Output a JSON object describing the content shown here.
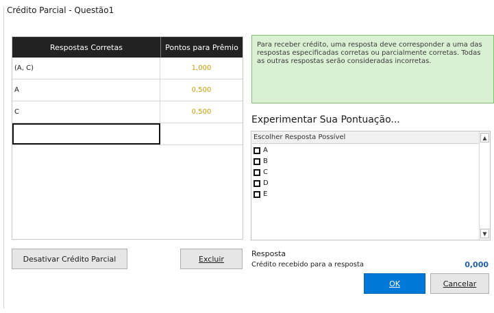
{
  "window": {
    "title": "Crédito Parcial - Questão1"
  },
  "answers_table": {
    "headers": [
      "Respostas Corretas",
      "Pontos para Prêmio"
    ],
    "rows": [
      {
        "answer": "(A, C)",
        "points": "1,000"
      },
      {
        "answer": "A",
        "points": "0,500"
      },
      {
        "answer": "C",
        "points": "0,500"
      },
      {
        "answer": "",
        "points": ""
      }
    ]
  },
  "buttons": {
    "disable_partial_credit": "Desativar Crédito Parcial",
    "delete": "Excluir",
    "ok": "OK",
    "cancel": "Cancelar"
  },
  "info_text": "Para receber crédito, uma resposta deve corresponder a uma das respostas especificadas corretas ou parcialmente corretas. Todas as outras respostas serão consideradas incorretas.",
  "try_score": {
    "title": "Experimentar Sua Pontuação...",
    "list_header": "Escolher Resposta Possível",
    "options": [
      "A",
      "B",
      "C",
      "D",
      "E"
    ]
  },
  "result": {
    "response_label": "Resposta",
    "credit_label": "Crédito recebido para a resposta",
    "credit_value": "0,000"
  },
  "colors": {
    "points": "#c99a00",
    "ok_button": "#0078d7",
    "info_bg": "#d9f0d3",
    "credit_value": "#1f5fa8"
  },
  "icons": [
    "scroll-up-icon",
    "scroll-down-icon"
  ]
}
